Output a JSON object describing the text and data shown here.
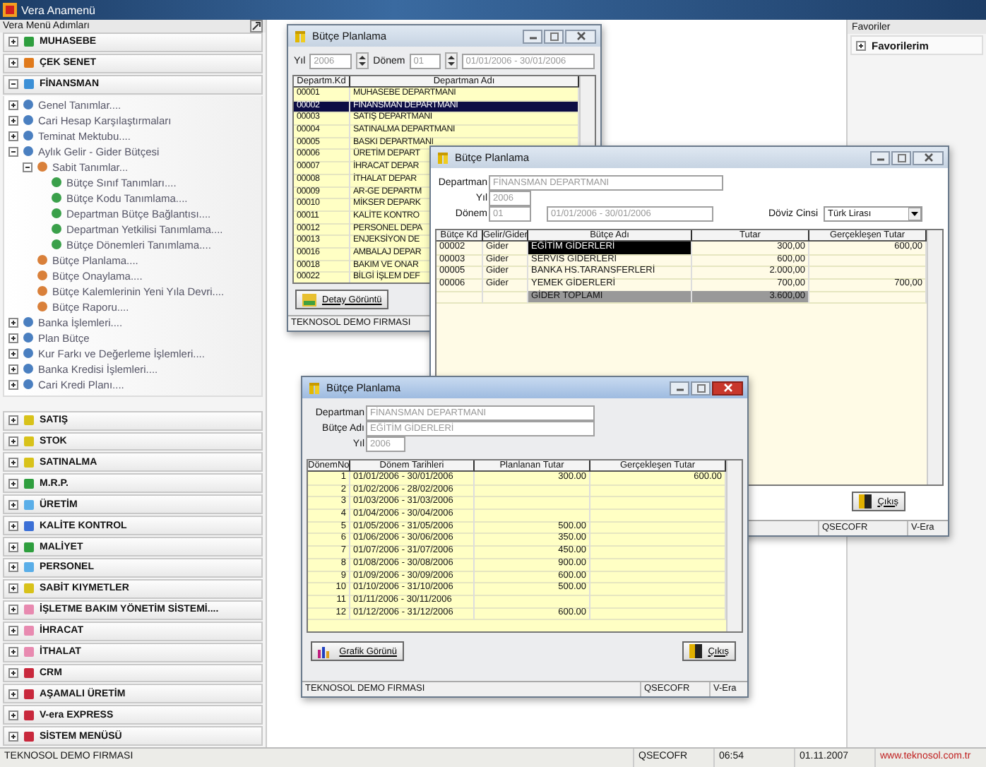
{
  "app": {
    "title": "Vera Anamenü"
  },
  "menu": {
    "title": "Vera Menü Adımları",
    "sections": [
      {
        "label": "MUHASEBE",
        "color": "#2e9e3e",
        "expanded": false
      },
      {
        "label": "ÇEK SENET",
        "color": "#e07a1c",
        "expanded": false
      },
      {
        "label": "FİNANSMAN",
        "color": "#3b8fd6",
        "expanded": true,
        "tree": [
          {
            "label": "Genel Tanımlar....",
            "expanded": false
          },
          {
            "label": "Cari Hesap Karşılaştırmaları",
            "expanded": false
          },
          {
            "label": "Teminat Mektubu....",
            "expanded": false
          },
          {
            "label": "Aylık Gelir - Gider Bütçesi",
            "expanded": true,
            "children": [
              {
                "label": "Sabit Tanımlar...",
                "expanded": true,
                "children": [
                  {
                    "label": "Bütçe Sınıf Tanımları...."
                  },
                  {
                    "label": "Bütçe Kodu Tanımlama...."
                  },
                  {
                    "label": "Departman Bütçe Bağlantısı...."
                  },
                  {
                    "label": "Departman Yetkilisi Tanımlama...."
                  },
                  {
                    "label": "Bütçe Dönemleri Tanımlama...."
                  }
                ]
              },
              {
                "label": "Bütçe Planlama...."
              },
              {
                "label": "Bütçe Onaylama...."
              },
              {
                "label": "Bütçe Kalemlerinin Yeni Yıla Devri...."
              },
              {
                "label": "Bütçe Raporu...."
              }
            ]
          },
          {
            "label": "Banka İşlemleri....",
            "expanded": false
          },
          {
            "label": "Plan Bütçe",
            "expanded": false
          },
          {
            "label": "Kur Farkı ve Değerleme İşlemleri....",
            "expanded": false
          },
          {
            "label": "Banka Kredisi İşlemleri....",
            "expanded": false
          },
          {
            "label": "Cari Kredi Planı....",
            "expanded": false
          }
        ]
      },
      {
        "label": "SATIŞ",
        "color": "#d8c21a",
        "expanded": false
      },
      {
        "label": "STOK",
        "color": "#d8c21a",
        "expanded": false
      },
      {
        "label": "SATINALMA",
        "color": "#d8c21a",
        "expanded": false
      },
      {
        "label": "M.R.P.",
        "color": "#2e9e3e",
        "expanded": false
      },
      {
        "label": "ÜRETİM",
        "color": "#5aaee8",
        "expanded": false
      },
      {
        "label": "KALİTE KONTROL",
        "color": "#3b6fd6",
        "expanded": false
      },
      {
        "label": "MALİYET",
        "color": "#2e9e3e",
        "expanded": false
      },
      {
        "label": "PERSONEL",
        "color": "#5aaee8",
        "expanded": false
      },
      {
        "label": "SABİT KIYMETLER",
        "color": "#d8c21a",
        "expanded": false
      },
      {
        "label": "İŞLETME BAKIM YÖNETİM SİSTEMİ....",
        "color": "#e88ab0",
        "expanded": false
      },
      {
        "label": "İHRACAT",
        "color": "#e88ab0",
        "expanded": false
      },
      {
        "label": "İTHALAT",
        "color": "#e88ab0",
        "expanded": false
      },
      {
        "label": "CRM",
        "color": "#c8283c",
        "expanded": false
      },
      {
        "label": "AŞAMALI ÜRETİM",
        "color": "#c8283c",
        "expanded": false
      },
      {
        "label": "V-era EXPRESS",
        "color": "#c8283c",
        "expanded": false
      },
      {
        "label": "SİSTEM MENÜSÜ",
        "color": "#c8283c",
        "expanded": false
      }
    ]
  },
  "favorites": {
    "title": "Favoriler",
    "items": [
      {
        "label": "Favorilerim",
        "expanded": false
      }
    ]
  },
  "department_window": {
    "title": "Bütçe Planlama",
    "year_label": "Yıl",
    "year": "2006",
    "period_label": "Dönem",
    "period": "01",
    "date_range": "01/01/2006 - 30/01/2006",
    "columns": [
      "Departm.Kd",
      "Departman Adı"
    ],
    "rows": [
      {
        "code": "00001",
        "name": "MUHASEBE DEPARTMANI",
        "selected": false
      },
      {
        "code": "00002",
        "name": "FİNANSMAN DEPARTMANI",
        "selected": true
      },
      {
        "code": "00003",
        "name": "SATIŞ DEPARTMANI",
        "selected": false
      },
      {
        "code": "00004",
        "name": "SATINALMA DEPARTMANI",
        "selected": false
      },
      {
        "code": "00005",
        "name": "BASKI DEPARTMANI",
        "selected": false
      },
      {
        "code": "00006",
        "name": "ÜRETİM DEPART",
        "selected": false
      },
      {
        "code": "00007",
        "name": "İHRACAT DEPAR",
        "selected": false
      },
      {
        "code": "00008",
        "name": "İTHALAT DEPAR",
        "selected": false
      },
      {
        "code": "00009",
        "name": "AR-GE DEPARTM",
        "selected": false
      },
      {
        "code": "00010",
        "name": "MİKSER DEPARK",
        "selected": false
      },
      {
        "code": "00011",
        "name": "KALİTE KONTRO",
        "selected": false
      },
      {
        "code": "00012",
        "name": "PERSONEL DEPA",
        "selected": false
      },
      {
        "code": "00013",
        "name": "ENJEKSİYON DE",
        "selected": false
      },
      {
        "code": "00016",
        "name": "AMBALAJ DEPAR",
        "selected": false
      },
      {
        "code": "00018",
        "name": "BAKIM VE ONAR",
        "selected": false
      },
      {
        "code": "00022",
        "name": "BİLGİ İŞLEM DEF",
        "selected": false
      }
    ],
    "detail_button": "Detay Görüntü",
    "status": "TEKNOSOL DEMO FIRMASI"
  },
  "budget_window": {
    "title": "Bütçe Planlama",
    "department_label": "Departman",
    "department": "FİNANSMAN DEPARTMANI",
    "year_label": "Yıl",
    "year": "2006",
    "period_label": "Dönem",
    "period": "01",
    "date_range": "01/01/2006 - 30/01/2006",
    "currency_label": "Döviz Cinsi",
    "currency": "Türk Lirası",
    "columns": [
      "Bütçe Kd",
      "Gelir/Gider",
      "Bütçe Adı",
      "Tutar",
      "Gerçekleşen Tutar"
    ],
    "rows": [
      {
        "kind": "item",
        "code": "00002",
        "type": "Gider",
        "name": "EĞİTİM GİDERLERİ",
        "amount": "300,00",
        "actual": "600,00",
        "selected": true
      },
      {
        "kind": "item",
        "code": "00003",
        "type": "Gider",
        "name": "SERVİS GİDERLERİ",
        "amount": "600,00",
        "selected": false
      },
      {
        "kind": "item",
        "code": "00005",
        "type": "Gider",
        "name": "BANKA HS.TARANSFERLERİ",
        "amount": "2.000,00",
        "selected": false
      },
      {
        "kind": "item",
        "code": "00006",
        "type": "Gider",
        "name": "YEMEK GİDERLERİ",
        "amount": "700,00",
        "actual": "700,00",
        "selected": false
      },
      {
        "kind": "total",
        "name": "GİDER TOPLAMI",
        "amount": "3.600,00",
        "selected": false
      }
    ],
    "exit_button": "Çıkış",
    "status_user": "QSECOFR",
    "status_app": "V-Era"
  },
  "period_window": {
    "title": "Bütçe Planlama",
    "department_label": "Departman",
    "department": "FİNANSMAN DEPARTMANI",
    "budget_label": "Bütçe Adı",
    "budget": "EĞİTİM GİDERLERİ",
    "year_label": "Yıl",
    "year": "2006",
    "columns": [
      "DönemNo",
      "Dönem Tarihleri",
      "Planlanan Tutar",
      "Gerçekleşen Tutar"
    ],
    "rows": [
      {
        "no": "1",
        "dates": "01/01/2006 - 30/01/2006",
        "planned": "300.00",
        "actual": "600.00"
      },
      {
        "no": "2",
        "dates": "01/02/2006 - 28/02/2006"
      },
      {
        "no": "3",
        "dates": "01/03/2006 - 31/03/2006"
      },
      {
        "no": "4",
        "dates": "01/04/2006 - 30/04/2006"
      },
      {
        "no": "5",
        "dates": "01/05/2006 - 31/05/2006",
        "planned": "500.00"
      },
      {
        "no": "6",
        "dates": "01/06/2006 - 30/06/2006",
        "planned": "350.00"
      },
      {
        "no": "7",
        "dates": "01/07/2006 - 31/07/2006",
        "planned": "450.00"
      },
      {
        "no": "8",
        "dates": "01/08/2006 - 30/08/2006",
        "planned": "900.00"
      },
      {
        "no": "9",
        "dates": "01/09/2006 - 30/09/2006",
        "planned": "600.00"
      },
      {
        "no": "10",
        "dates": "01/10/2006 - 31/10/2006",
        "planned": "500.00"
      },
      {
        "no": "11",
        "dates": "01/11/2006 - 30/11/2006"
      },
      {
        "no": "12",
        "dates": "01/12/2006 - 31/12/2006",
        "planned": "600.00"
      }
    ],
    "chart_button": "Grafik Görünü",
    "exit_button": "Çıkış",
    "status": "TEKNOSOL DEMO FIRMASI",
    "status_user": "QSECOFR",
    "status_app": "V-Era"
  },
  "status_bar": {
    "company": "TEKNOSOL DEMO FIRMASI",
    "user": "QSECOFR",
    "time": "06:54",
    "date": "01.11.2007",
    "website": "www.teknosol.com.tr"
  }
}
